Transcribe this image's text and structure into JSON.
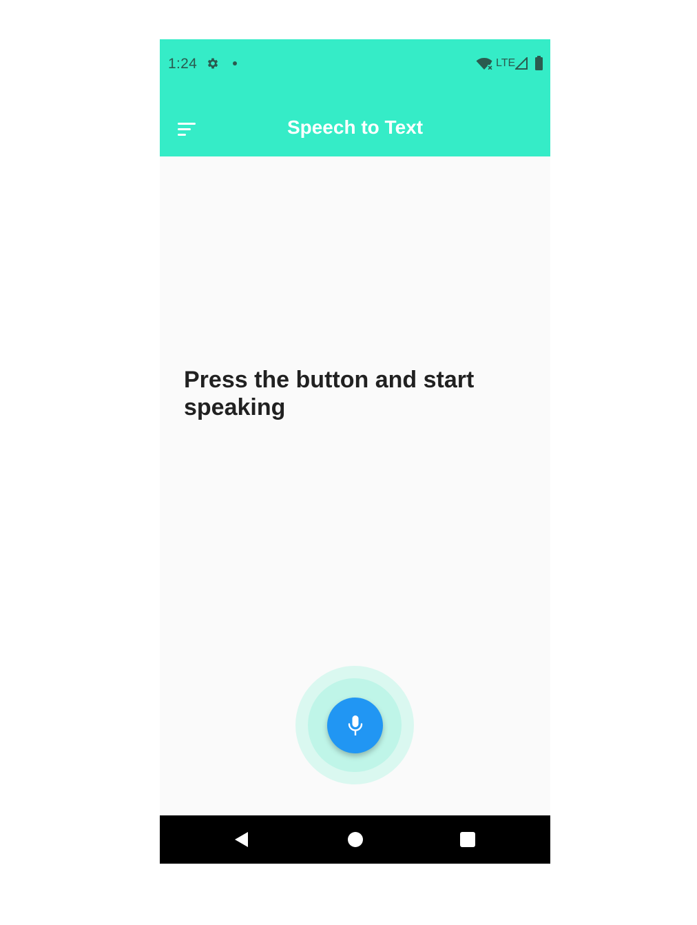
{
  "status_bar": {
    "time": "1:24",
    "network_label": "LTE",
    "icons": [
      "gear-icon",
      "notification-dot-icon",
      "wifi-off-icon",
      "signal-icon",
      "battery-icon"
    ]
  },
  "app_bar": {
    "title": "Speech to Text",
    "menu_icon": "sort-menu-icon",
    "background_color": "#35ecc7"
  },
  "main": {
    "prompt": "Press the button and start speaking"
  },
  "mic": {
    "icon": "microphone-icon",
    "button_color": "#2196f3",
    "ring_color": "#bff5e8"
  },
  "nav_bar": {
    "icons": [
      "back-icon",
      "home-icon",
      "recents-icon"
    ]
  }
}
